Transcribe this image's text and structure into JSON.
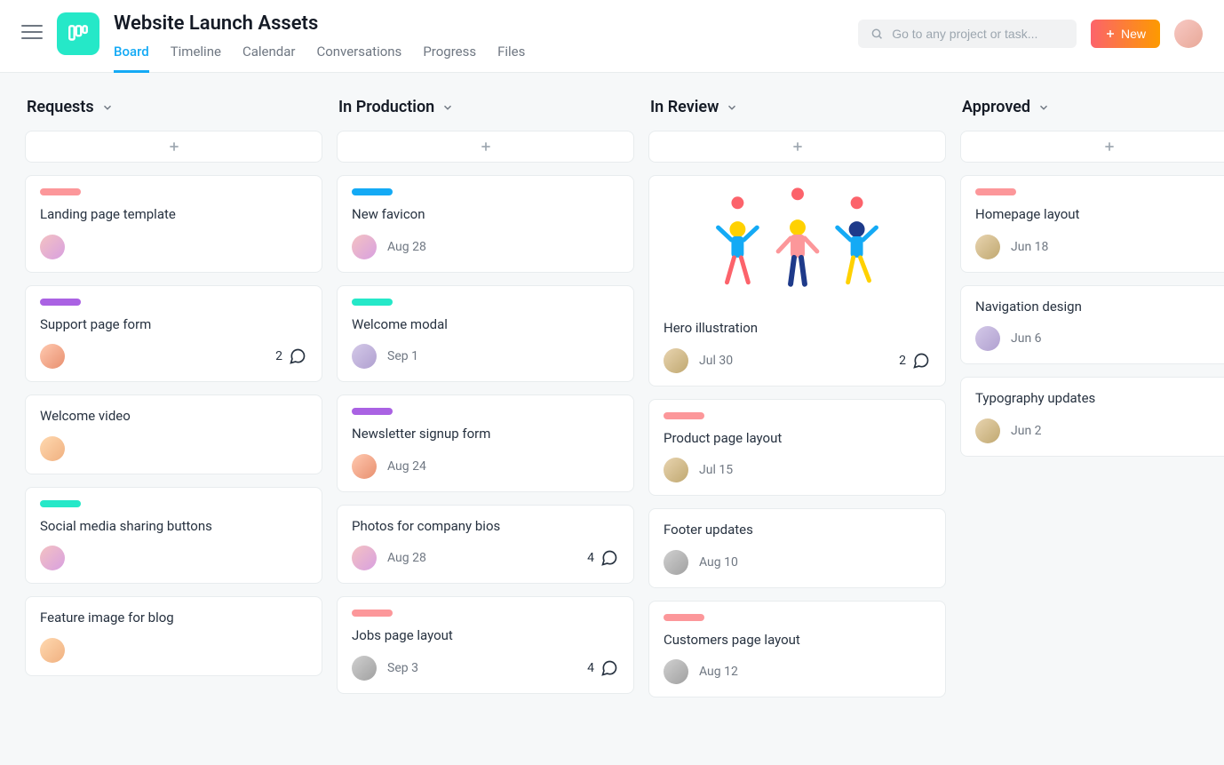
{
  "header": {
    "title": "Website Launch Assets",
    "tabs": [
      "Board",
      "Timeline",
      "Calendar",
      "Conversations",
      "Progress",
      "Files"
    ],
    "activeTab": 0,
    "searchPlaceholder": "Go to any project or task...",
    "newButton": "New"
  },
  "columns": [
    {
      "title": "Requests",
      "cards": [
        {
          "tag": "pink",
          "title": "Landing page template",
          "avatar": "av-1",
          "date": null,
          "comments": null
        },
        {
          "tag": "purple",
          "title": "Support page form",
          "avatar": "av-2",
          "date": null,
          "comments": 2
        },
        {
          "tag": null,
          "title": "Welcome video",
          "avatar": "av-5",
          "date": null,
          "comments": null
        },
        {
          "tag": "teal",
          "title": "Social media sharing buttons",
          "avatar": "av-1",
          "date": null,
          "comments": null
        },
        {
          "tag": null,
          "title": "Feature image for blog",
          "avatar": "av-5",
          "date": null,
          "comments": null
        }
      ]
    },
    {
      "title": "In Production",
      "cards": [
        {
          "tag": "blue",
          "title": "New favicon",
          "avatar": "av-1",
          "date": "Aug 28",
          "comments": null
        },
        {
          "tag": "teal",
          "title": "Welcome modal",
          "avatar": "av-3",
          "date": "Sep 1",
          "comments": null
        },
        {
          "tag": "purple",
          "title": "Newsletter signup form",
          "avatar": "av-2",
          "date": "Aug 24",
          "comments": null
        },
        {
          "tag": null,
          "title": "Photos for company bios",
          "avatar": "av-1",
          "date": "Aug 28",
          "comments": 4
        },
        {
          "tag": "pink",
          "title": "Jobs page layout",
          "avatar": "av-6",
          "date": "Sep 3",
          "comments": 4
        }
      ]
    },
    {
      "title": "In Review",
      "cards": [
        {
          "tag": null,
          "title": "Hero illustration",
          "avatar": "av-4",
          "date": "Jul 30",
          "comments": 2,
          "hero": true
        },
        {
          "tag": "pink",
          "title": "Product page layout",
          "avatar": "av-4",
          "date": "Jul 15",
          "comments": null
        },
        {
          "tag": null,
          "title": "Footer updates",
          "avatar": "av-6",
          "date": "Aug 10",
          "comments": null
        },
        {
          "tag": "pink",
          "title": "Customers page layout",
          "avatar": "av-6",
          "date": "Aug 12",
          "comments": null
        }
      ]
    },
    {
      "title": "Approved",
      "cards": [
        {
          "tag": "pink",
          "title": "Homepage layout",
          "avatar": "av-4",
          "date": "Jun 18",
          "comments": null
        },
        {
          "tag": null,
          "title": "Navigation design",
          "avatar": "av-3",
          "date": "Jun 6",
          "comments": null
        },
        {
          "tag": null,
          "title": "Typography updates",
          "avatar": "av-4",
          "date": "Jun 2",
          "comments": null
        }
      ]
    }
  ]
}
